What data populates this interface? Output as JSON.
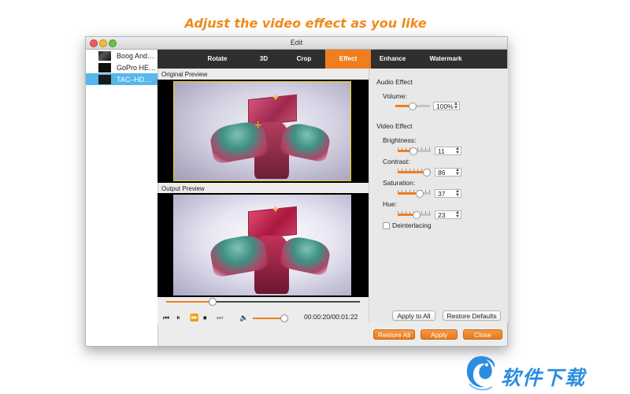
{
  "headline": "Adjust the video effect as you like",
  "colors": {
    "accent": "#f07e1e",
    "headline": "#f08a1c",
    "selection": "#57b7ec",
    "tabbar": "#2f2f2f",
    "watermark": "#2b8de0"
  },
  "window": {
    "title": "Edit"
  },
  "files": [
    {
      "name": "Boog And…"
    },
    {
      "name": "GoPro HE…"
    },
    {
      "name": "TAC–HD…"
    }
  ],
  "tabs": [
    "Rotate",
    "3D",
    "Crop",
    "Effect",
    "Enhance",
    "Watermark"
  ],
  "active_tab": "Effect",
  "preview": {
    "original_label": "Original Preview",
    "output_label": "Output Preview"
  },
  "player": {
    "progress_fraction": 0.24,
    "volume_fraction": 0.95,
    "timecode": "00:00:20/00:01:22",
    "icons": [
      "skip-back-icon",
      "pause-icon",
      "fast-forward-icon",
      "stop-icon",
      "skip-forward-icon",
      "speaker-icon"
    ]
  },
  "effects": {
    "audio_title": "Audio Effect",
    "volume_label": "Volume:",
    "volume_value": "100%",
    "video_title": "Video Effect",
    "brightness_label": "Brightness:",
    "brightness_value": "11",
    "contrast_label": "Contrast:",
    "contrast_value": "86",
    "saturation_label": "Saturation:",
    "saturation_value": "37",
    "hue_label": "Hue:",
    "hue_value": "23",
    "deinterlacing_label": "Deinterlacing",
    "deinterlacing_checked": false
  },
  "buttons": {
    "apply_to_all": "Apply to All",
    "restore_defaults": "Restore Defaults",
    "restore_all": "Restore All",
    "apply": "Apply",
    "close": "Close"
  },
  "watermark_text": "软件下载"
}
